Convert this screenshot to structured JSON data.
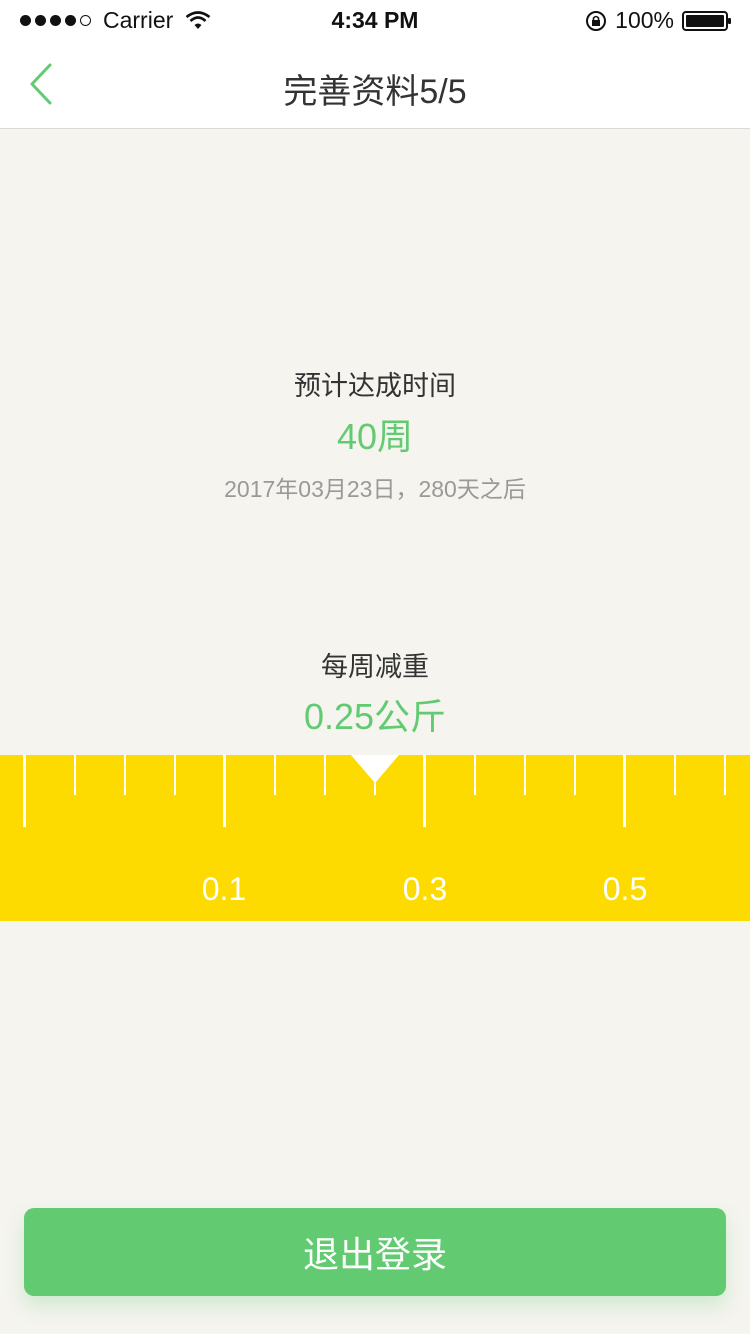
{
  "status_bar": {
    "carrier": "Carrier",
    "time": "4:34 PM",
    "battery": "100%"
  },
  "nav": {
    "back_icon": "chevron-left-icon",
    "title": "完善资料5/5"
  },
  "estimate": {
    "label": "预计达成时间",
    "value": "40周",
    "detail": "2017年03月23日，280天之后"
  },
  "weekly_loss": {
    "label": "每周减重",
    "value": "0.25公斤"
  },
  "ruler": {
    "labels": [
      "0.1",
      "0.3",
      "0.5"
    ],
    "selected_value": 0.25
  },
  "logout": {
    "label": "退出登录"
  },
  "colors": {
    "accent_green": "#62cb72",
    "ruler_yellow": "#fedb00",
    "background": "#f5f4ef"
  }
}
